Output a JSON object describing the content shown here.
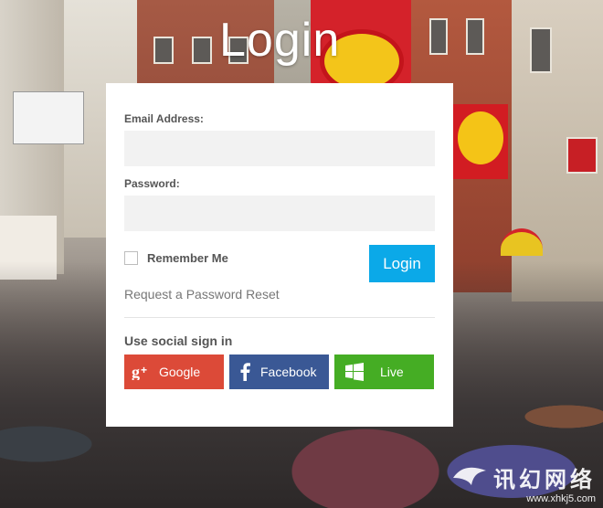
{
  "page": {
    "title": "Login"
  },
  "form": {
    "email_label": "Email Address:",
    "email_value": "",
    "password_label": "Password:",
    "password_value": "",
    "remember_label": "Remember Me",
    "remember_checked": false,
    "login_button": "Login",
    "reset_link": "Request a Password Reset"
  },
  "social": {
    "title": "Use social sign in",
    "google": "Google",
    "facebook": "Facebook",
    "live": "Live"
  },
  "watermark": {
    "text": "讯幻网络",
    "url": "www.xhkj5.com"
  },
  "colors": {
    "accent": "#0ba9e8",
    "google": "#dc4a38",
    "facebook": "#3a5895",
    "live": "#45ad24"
  }
}
